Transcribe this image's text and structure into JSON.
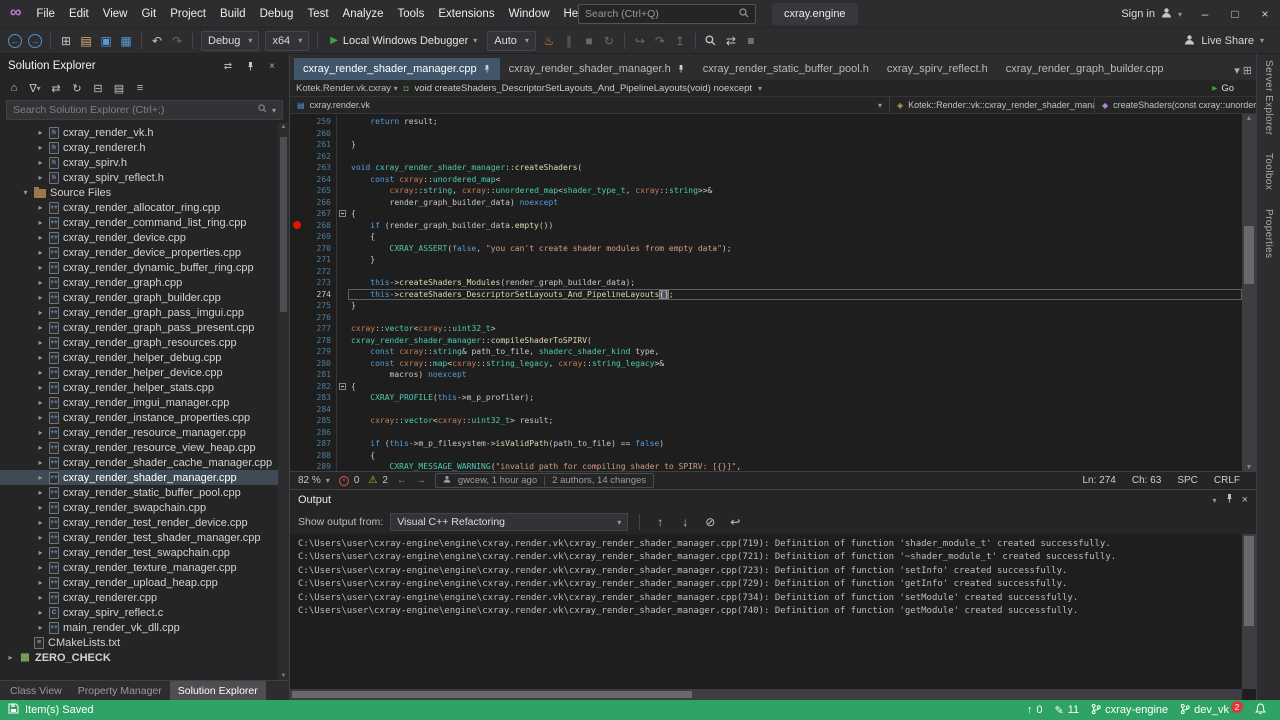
{
  "window": {
    "title": "cxray.engine",
    "menus": [
      "File",
      "Edit",
      "View",
      "Git",
      "Project",
      "Build",
      "Debug",
      "Test",
      "Analyze",
      "Tools",
      "Extensions",
      "Window",
      "Help"
    ],
    "search_placeholder": "Search (Ctrl+Q)",
    "sign_in": "Sign in"
  },
  "toolbar": {
    "configuration": "Debug",
    "platform": "x64",
    "start_button": "Local Windows Debugger",
    "watch_mode": "Auto",
    "live_share": "Live Share"
  },
  "solution_explorer": {
    "title": "Solution Explorer",
    "search_placeholder": "Search Solution Explorer (Ctrl+;)",
    "bottom_tabs": [
      "Class View",
      "Property Manager",
      "Solution Explorer"
    ],
    "active_bottom_tab": "Solution Explorer",
    "items": [
      {
        "label": "cxray_render_vk.h",
        "icon": "h",
        "indent": 2,
        "arrow": true
      },
      {
        "label": "cxray_renderer.h",
        "icon": "h",
        "indent": 2,
        "arrow": true
      },
      {
        "label": "cxray_spirv.h",
        "icon": "h",
        "indent": 2,
        "arrow": true
      },
      {
        "label": "cxray_spirv_reflect.h",
        "icon": "h",
        "indent": 2,
        "arrow": true
      },
      {
        "label": "Source Files",
        "icon": "folder",
        "indent": 1,
        "arrow": true,
        "expanded": true
      },
      {
        "label": "cxray_render_allocator_ring.cpp",
        "icon": "cpp",
        "indent": 2,
        "arrow": true
      },
      {
        "label": "cxray_render_command_list_ring.cpp",
        "icon": "cpp",
        "indent": 2,
        "arrow": true
      },
      {
        "label": "cxray_render_device.cpp",
        "icon": "cpp",
        "indent": 2,
        "arrow": true
      },
      {
        "label": "cxray_render_device_properties.cpp",
        "icon": "cpp",
        "indent": 2,
        "arrow": true
      },
      {
        "label": "cxray_render_dynamic_buffer_ring.cpp",
        "icon": "cpp",
        "indent": 2,
        "arrow": true
      },
      {
        "label": "cxray_render_graph.cpp",
        "icon": "cpp",
        "indent": 2,
        "arrow": true
      },
      {
        "label": "cxray_render_graph_builder.cpp",
        "icon": "cpp",
        "indent": 2,
        "arrow": true
      },
      {
        "label": "cxray_render_graph_pass_imgui.cpp",
        "icon": "cpp",
        "indent": 2,
        "arrow": true
      },
      {
        "label": "cxray_render_graph_pass_present.cpp",
        "icon": "cpp",
        "indent": 2,
        "arrow": true
      },
      {
        "label": "cxray_render_graph_resources.cpp",
        "icon": "cpp",
        "indent": 2,
        "arrow": true
      },
      {
        "label": "cxray_render_helper_debug.cpp",
        "icon": "cpp",
        "indent": 2,
        "arrow": true
      },
      {
        "label": "cxray_render_helper_device.cpp",
        "icon": "cpp",
        "indent": 2,
        "arrow": true
      },
      {
        "label": "cxray_render_helper_stats.cpp",
        "icon": "cpp",
        "indent": 2,
        "arrow": true
      },
      {
        "label": "cxray_render_imgui_manager.cpp",
        "icon": "cpp",
        "indent": 2,
        "arrow": true
      },
      {
        "label": "cxray_render_instance_properties.cpp",
        "icon": "cpp",
        "indent": 2,
        "arrow": true
      },
      {
        "label": "cxray_render_resource_manager.cpp",
        "icon": "cpp",
        "indent": 2,
        "arrow": true
      },
      {
        "label": "cxray_render_resource_view_heap.cpp",
        "icon": "cpp",
        "indent": 2,
        "arrow": true
      },
      {
        "label": "cxray_render_shader_cache_manager.cpp",
        "icon": "cpp",
        "indent": 2,
        "arrow": true
      },
      {
        "label": "cxray_render_shader_manager.cpp",
        "icon": "cpp",
        "indent": 2,
        "arrow": true,
        "selected": true
      },
      {
        "label": "cxray_render_static_buffer_pool.cpp",
        "icon": "cpp",
        "indent": 2,
        "arrow": true
      },
      {
        "label": "cxray_render_swapchain.cpp",
        "icon": "cpp",
        "indent": 2,
        "arrow": true
      },
      {
        "label": "cxray_render_test_render_device.cpp",
        "icon": "cpp",
        "indent": 2,
        "arrow": true
      },
      {
        "label": "cxray_render_test_shader_manager.cpp",
        "icon": "cpp",
        "indent": 2,
        "arrow": true
      },
      {
        "label": "cxray_render_test_swapchain.cpp",
        "icon": "cpp",
        "indent": 2,
        "arrow": true
      },
      {
        "label": "cxray_render_texture_manager.cpp",
        "icon": "cpp",
        "indent": 2,
        "arrow": true
      },
      {
        "label": "cxray_render_upload_heap.cpp",
        "icon": "cpp",
        "indent": 2,
        "arrow": true
      },
      {
        "label": "cxray_renderer.cpp",
        "icon": "cpp",
        "indent": 2,
        "arrow": true
      },
      {
        "label": "cxray_spirv_reflect.c",
        "icon": "c",
        "indent": 2,
        "arrow": true
      },
      {
        "label": "main_render_vk_dll.cpp",
        "icon": "cpp",
        "indent": 2,
        "arrow": true
      },
      {
        "label": "CMakeLists.txt",
        "icon": "txt",
        "indent": 1
      },
      {
        "label": "ZERO_CHECK",
        "icon": "project",
        "indent": 0,
        "arrow": true,
        "bold": true
      }
    ]
  },
  "editor": {
    "tabs": [
      {
        "label": "cxray_render_shader_manager.cpp",
        "active": true,
        "pinned": true
      },
      {
        "label": "cxray_render_shader_manager.h",
        "pinned": true
      },
      {
        "label": "cxray_render_static_buffer_pool.h"
      },
      {
        "label": "cxray_spirv_reflect.h"
      },
      {
        "label": "cxray_render_graph_builder.cpp"
      }
    ],
    "navbar_top": {
      "scope": "Kotek.Render.vk.cxray",
      "signature": "void createShaders_DescriptorSetLayouts_And_PipelineLayouts(void) noexcept",
      "go_label": "Go"
    },
    "navbar_document": {
      "project": "cxray.render.vk",
      "type": "Kotek::Render::vk::cxray_render_shader_manager",
      "member": "createShaders(const cxray::unordered_map<cxray::string,cxray::u"
    },
    "code_lines": [
      {
        "n": 259,
        "t": [
          [
            "    ",
            "p"
          ],
          [
            "return",
            "k"
          ],
          [
            " result;",
            "p"
          ]
        ]
      },
      {
        "n": 260,
        "t": []
      },
      {
        "n": 261,
        "t": [
          [
            "}",
            "p"
          ]
        ]
      },
      {
        "n": 262,
        "t": []
      },
      {
        "n": 263,
        "t": [
          [
            "void",
            "k"
          ],
          [
            " ",
            "p"
          ],
          [
            "cxray_render_shader_manager",
            "t"
          ],
          [
            "::",
            "p"
          ],
          [
            "createShaders",
            "f"
          ],
          [
            "(",
            "p"
          ]
        ]
      },
      {
        "n": 264,
        "t": [
          [
            "    ",
            "p"
          ],
          [
            "const",
            "k"
          ],
          [
            " ",
            "p"
          ],
          [
            "cxray",
            "o"
          ],
          [
            "::",
            "p"
          ],
          [
            "unordered_map",
            "t"
          ],
          [
            "<",
            "p"
          ]
        ]
      },
      {
        "n": 265,
        "t": [
          [
            "        ",
            "p"
          ],
          [
            "cxray",
            "o"
          ],
          [
            "::",
            "p"
          ],
          [
            "string",
            "t"
          ],
          [
            ", ",
            "p"
          ],
          [
            "cxray",
            "o"
          ],
          [
            "::",
            "p"
          ],
          [
            "unordered_map",
            "t"
          ],
          [
            "<",
            "p"
          ],
          [
            "shader_type_t",
            "t"
          ],
          [
            ", ",
            "p"
          ],
          [
            "cxray",
            "o"
          ],
          [
            "::",
            "p"
          ],
          [
            "string",
            "t"
          ],
          [
            ">>&",
            "p"
          ]
        ]
      },
      {
        "n": 266,
        "t": [
          [
            "        render_graph_builder_data) ",
            "p"
          ],
          [
            "noexcept",
            "k"
          ]
        ]
      },
      {
        "n": 267,
        "fold": true,
        "t": [
          [
            "{",
            "p"
          ]
        ]
      },
      {
        "n": 268,
        "bp": true,
        "t": [
          [
            "    ",
            "p"
          ],
          [
            "if",
            "k"
          ],
          [
            " (render_graph_builder_data.",
            "p"
          ],
          [
            "empty",
            "f"
          ],
          [
            "())",
            "p"
          ]
        ]
      },
      {
        "n": 269,
        "t": [
          [
            "    {",
            "p"
          ]
        ]
      },
      {
        "n": 270,
        "t": [
          [
            "        ",
            "p"
          ],
          [
            "CXRAY_ASSERT",
            "m"
          ],
          [
            "(",
            "p"
          ],
          [
            "false",
            "k"
          ],
          [
            ", ",
            "p"
          ],
          [
            "\"you can't create shader modules from empty data\"",
            "s"
          ],
          [
            ");",
            "p"
          ]
        ]
      },
      {
        "n": 271,
        "t": [
          [
            "    }",
            "p"
          ]
        ]
      },
      {
        "n": 272,
        "t": []
      },
      {
        "n": 273,
        "t": [
          [
            "    ",
            "p"
          ],
          [
            "this",
            "k"
          ],
          [
            "->",
            "p"
          ],
          [
            "createShaders_Modules",
            "f"
          ],
          [
            "(render_graph_builder_data);",
            "p"
          ]
        ]
      },
      {
        "n": 274,
        "cur": true,
        "t": [
          [
            "    ",
            "p"
          ],
          [
            "this",
            "k"
          ],
          [
            "->",
            "p"
          ],
          [
            "createShaders_DescriptorSetLayouts_And_PipelineLayouts",
            "f"
          ],
          [
            "()",
            "hl"
          ],
          [
            ";",
            "p"
          ]
        ]
      },
      {
        "n": 275,
        "t": [
          [
            "}",
            "p"
          ]
        ]
      },
      {
        "n": 276,
        "t": []
      },
      {
        "n": 277,
        "t": [
          [
            "cxray",
            "o"
          ],
          [
            "::",
            "p"
          ],
          [
            "vector",
            "t"
          ],
          [
            "<",
            "p"
          ],
          [
            "cxray",
            "o"
          ],
          [
            "::",
            "p"
          ],
          [
            "uint32_t",
            "t"
          ],
          [
            ">",
            "p"
          ]
        ]
      },
      {
        "n": 278,
        "t": [
          [
            "cxray_render_shader_manager",
            "t"
          ],
          [
            "::",
            "p"
          ],
          [
            "compileShaderToSPIRV",
            "f"
          ],
          [
            "(",
            "p"
          ]
        ]
      },
      {
        "n": 279,
        "t": [
          [
            "    ",
            "p"
          ],
          [
            "const",
            "k"
          ],
          [
            " ",
            "p"
          ],
          [
            "cxray",
            "o"
          ],
          [
            "::",
            "p"
          ],
          [
            "string",
            "t"
          ],
          [
            "& path_to_file, ",
            "p"
          ],
          [
            "shaderc_shader_kind",
            "t"
          ],
          [
            " type,",
            "p"
          ]
        ]
      },
      {
        "n": 280,
        "t": [
          [
            "    ",
            "p"
          ],
          [
            "const",
            "k"
          ],
          [
            " ",
            "p"
          ],
          [
            "cxray",
            "o"
          ],
          [
            "::",
            "p"
          ],
          [
            "map",
            "t"
          ],
          [
            "<",
            "p"
          ],
          [
            "cxray",
            "o"
          ],
          [
            "::",
            "p"
          ],
          [
            "string_legacy",
            "t"
          ],
          [
            ", ",
            "p"
          ],
          [
            "cxray",
            "o"
          ],
          [
            "::",
            "p"
          ],
          [
            "string_legacy",
            "t"
          ],
          [
            ">&",
            "p"
          ]
        ]
      },
      {
        "n": 281,
        "t": [
          [
            "        macros) ",
            "p"
          ],
          [
            "noexcept",
            "k"
          ]
        ]
      },
      {
        "n": 282,
        "fold": true,
        "t": [
          [
            "{",
            "p"
          ]
        ]
      },
      {
        "n": 283,
        "t": [
          [
            "    ",
            "p"
          ],
          [
            "CXRAY_PROFILE",
            "m"
          ],
          [
            "(",
            "p"
          ],
          [
            "this",
            "k"
          ],
          [
            "->m_p_profiler);",
            "p"
          ]
        ]
      },
      {
        "n": 284,
        "t": []
      },
      {
        "n": 285,
        "t": [
          [
            "    ",
            "p"
          ],
          [
            "cxray",
            "o"
          ],
          [
            "::",
            "p"
          ],
          [
            "vector",
            "t"
          ],
          [
            "<",
            "p"
          ],
          [
            "cxray",
            "o"
          ],
          [
            "::",
            "p"
          ],
          [
            "uint32_t",
            "t"
          ],
          [
            "> result;",
            "p"
          ]
        ]
      },
      {
        "n": 286,
        "t": []
      },
      {
        "n": 287,
        "t": [
          [
            "    ",
            "p"
          ],
          [
            "if",
            "k"
          ],
          [
            " (",
            "p"
          ],
          [
            "this",
            "k"
          ],
          [
            "->m_p_filesystem->",
            "p"
          ],
          [
            "isValidPath",
            "f"
          ],
          [
            "(path_to_file) == ",
            "p"
          ],
          [
            "false",
            "k"
          ],
          [
            ")",
            "p"
          ]
        ]
      },
      {
        "n": 288,
        "t": [
          [
            "    {",
            "p"
          ]
        ]
      },
      {
        "n": 289,
        "t": [
          [
            "        ",
            "p"
          ],
          [
            "CXRAY_MESSAGE_WARNING",
            "m"
          ],
          [
            "(",
            "p"
          ],
          [
            "\"invalid path for compiling shader to SPIRV: [{}]\"",
            "s"
          ],
          [
            ",",
            "p"
          ]
        ]
      }
    ],
    "doc_status": {
      "zoom": "82 %",
      "errors": "0",
      "warnings": "2",
      "blame": "gwcew, 1 hour ago",
      "changes": "2 authors, 14 changes",
      "line": "Ln: 274",
      "column": "Ch: 63",
      "spaces": "SPC",
      "line_ending": "CRLF"
    }
  },
  "output": {
    "title": "Output",
    "show_output_from_label": "Show output from:",
    "source": "Visual C++ Refactoring",
    "lines": [
      "C:\\Users\\user\\cxray-engine\\engine\\cxray.render.vk\\cxray_render_shader_manager.cpp(719): Definition of function 'shader_module_t' created successfully.",
      "C:\\Users\\user\\cxray-engine\\engine\\cxray.render.vk\\cxray_render_shader_manager.cpp(721): Definition of function '~shader_module_t' created successfully.",
      "C:\\Users\\user\\cxray-engine\\engine\\cxray.render.vk\\cxray_render_shader_manager.cpp(723): Definition of function 'setInfo' created successfully.",
      "C:\\Users\\user\\cxray-engine\\engine\\cxray.render.vk\\cxray_render_shader_manager.cpp(729): Definition of function 'getInfo' created successfully.",
      "C:\\Users\\user\\cxray-engine\\engine\\cxray.render.vk\\cxray_render_shader_manager.cpp(734): Definition of function 'setModule' created successfully.",
      "C:\\Users\\user\\cxray-engine\\engine\\cxray.render.vk\\cxray_render_shader_manager.cpp(740): Definition of function 'getModule' created successfully."
    ]
  },
  "right_panel_tabs": [
    "Server Explorer",
    "Toolbox",
    "Properties"
  ],
  "statusbar": {
    "message": "Item(s) Saved",
    "outgoing_commits": "0",
    "pending_changes": "11",
    "repository": "cxray-engine",
    "branch": "dev_vk",
    "notifications": "2"
  }
}
